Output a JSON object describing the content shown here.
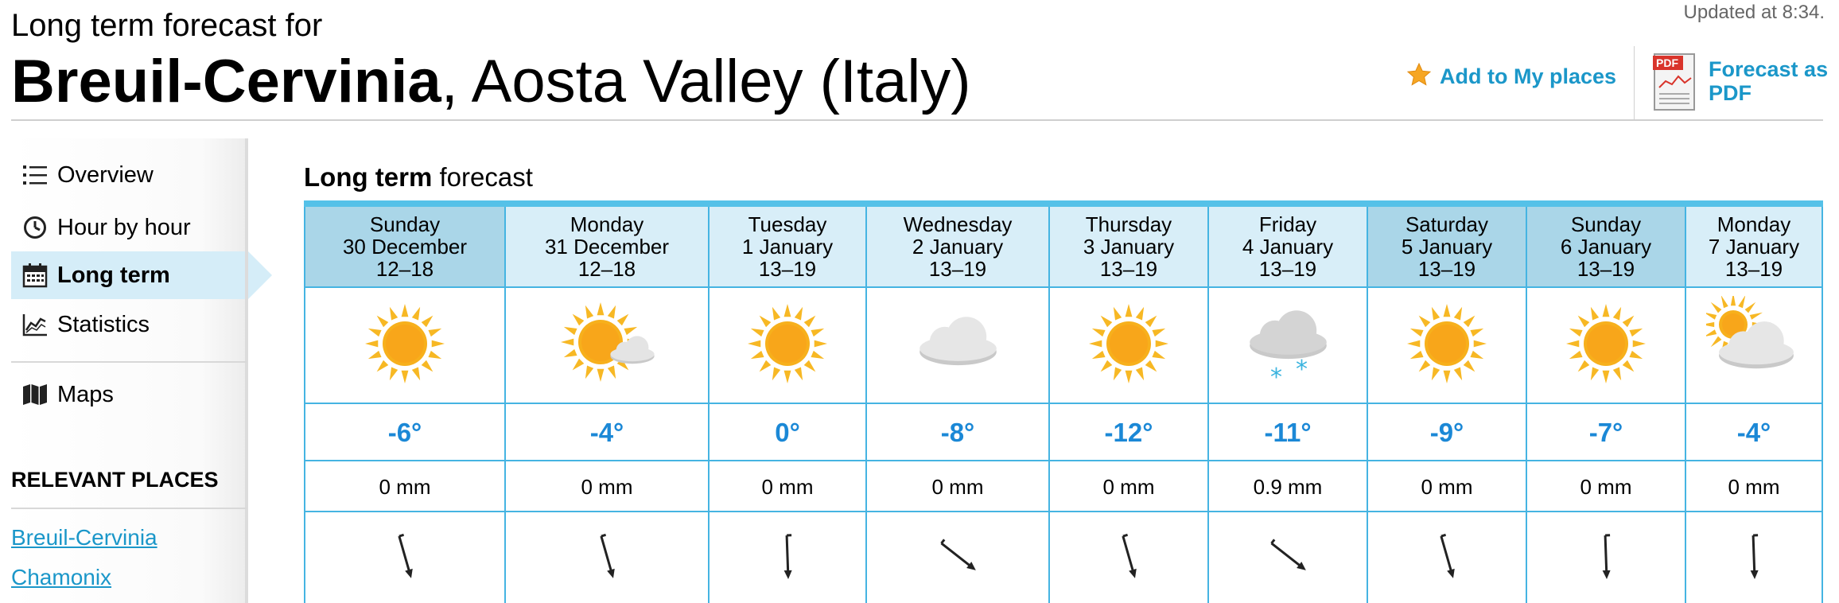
{
  "header": {
    "subtitle": "Long term forecast for",
    "place_bold": "Breuil-Cervinia",
    "place_rest": ", Aosta Valley (Italy)",
    "updated": "Updated at 8:34.",
    "add_places": "Add to My places",
    "pdf_label_1": "Forecast as",
    "pdf_label_2": "PDF",
    "pdf_badge": "PDF"
  },
  "sidebar": {
    "items": [
      {
        "label": "Overview",
        "icon": "list-icon"
      },
      {
        "label": "Hour by hour",
        "icon": "clock-icon"
      },
      {
        "label": "Long term",
        "icon": "calendar-icon",
        "active": true
      },
      {
        "label": "Statistics",
        "icon": "chart-icon"
      },
      {
        "label": "Maps",
        "icon": "map-icon"
      }
    ],
    "relevant_heading": "RELEVANT PLACES",
    "relevant_places": [
      "Breuil-Cervinia",
      "Chamonix"
    ]
  },
  "forecast": {
    "title_bold": "Long term",
    "title_rest": " forecast",
    "days": [
      {
        "day": "Sunday",
        "date": "30 December",
        "hours": "12–18",
        "weather": "sun",
        "temp": "-6°",
        "precip": "0 mm",
        "wind": "n-by-nw",
        "weekend": true
      },
      {
        "day": "Monday",
        "date": "31 December",
        "hours": "12–18",
        "weather": "partly-cloudy",
        "temp": "-4°",
        "precip": "0 mm",
        "wind": "n-by-nw",
        "weekend": false
      },
      {
        "day": "Tuesday",
        "date": "1 January",
        "hours": "13–19",
        "weather": "sun",
        "temp": "0°",
        "precip": "0 mm",
        "wind": "n",
        "weekend": false
      },
      {
        "day": "Wednesday",
        "date": "2 January",
        "hours": "13–19",
        "weather": "cloudy",
        "temp": "-8°",
        "precip": "0 mm",
        "wind": "nw",
        "weekend": false
      },
      {
        "day": "Thursday",
        "date": "3 January",
        "hours": "13–19",
        "weather": "sun",
        "temp": "-12°",
        "precip": "0 mm",
        "wind": "n-by-nw",
        "weekend": false
      },
      {
        "day": "Friday",
        "date": "4 January",
        "hours": "13–19",
        "weather": "snow",
        "temp": "-11°",
        "precip": "0.9 mm",
        "wind": "nw",
        "weekend": false
      },
      {
        "day": "Saturday",
        "date": "5 January",
        "hours": "13–19",
        "weather": "sun",
        "temp": "-9°",
        "precip": "0 mm",
        "wind": "n-by-nw",
        "weekend": true
      },
      {
        "day": "Sunday",
        "date": "6 January",
        "hours": "13–19",
        "weather": "sun",
        "temp": "-7°",
        "precip": "0 mm",
        "wind": "n",
        "weekend": true
      },
      {
        "day": "Monday",
        "date": "7 January",
        "hours": "13–19",
        "weather": "mostly-cloudy",
        "temp": "-4°",
        "precip": "0 mm",
        "wind": "n",
        "weekend": false
      }
    ]
  },
  "colors": {
    "accent": "#1b97c9",
    "temp": "#1b88d6",
    "grid": "#45b4e2",
    "header_bg": "#d8eef8",
    "weekend_bg": "#aad6e8"
  }
}
